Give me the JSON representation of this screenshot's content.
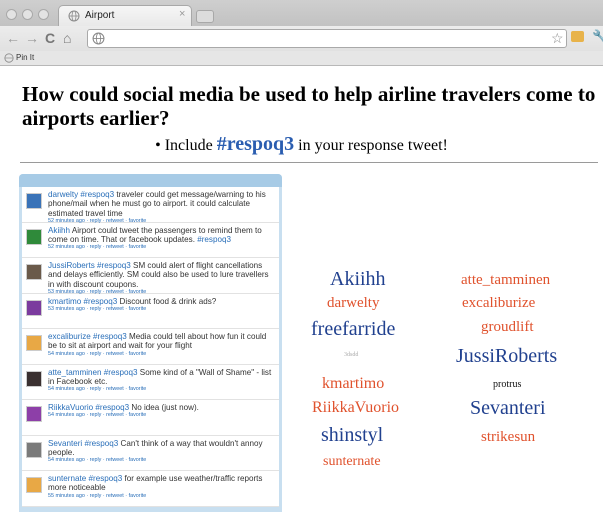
{
  "browser": {
    "tab_title": "Airport",
    "tab_close": "×",
    "bookmark_label": "Pin It",
    "nav": {
      "back": "←",
      "forward": "→",
      "reload": "C",
      "home": "⌂",
      "star": "☆",
      "wrench": "🔧"
    }
  },
  "page": {
    "headline": "How could social media be used to help airline travelers come to airports earlier?",
    "instruction_prefix": "• Include",
    "hashtag": "#respoq3",
    "instruction_suffix": "in your response tweet!"
  },
  "tweets": [
    {
      "user": "darwelty",
      "tag": "#respoq3",
      "text": " traveler could get message/warning to his phone/mail when he must go to airport. it could calculate estimated travel time",
      "meta": "52 minutes ago · reply · retweet · favorite",
      "avatar_color": "#3a73b8"
    },
    {
      "user": "Akiihh",
      "tag": "",
      "text": " Airport could tweet the passengers to remind them to come on time. That or facebook updates. ",
      "tag_after": "#respoq3",
      "meta": "52 minutes ago · reply · retweet · favorite",
      "avatar_color": "#2f8a3a"
    },
    {
      "user": "JussiRoberts",
      "tag": "#respoq3",
      "text": " SM could alert of flight cancellations and delays efficiently. SM could also be used to lure travellers in with discount coupons.",
      "meta": "53 minutes ago · reply · retweet · favorite",
      "avatar_color": "#6a5a4a"
    },
    {
      "user": "kmartimo",
      "tag": "#respoq3",
      "text": " Discount food & drink ads?",
      "meta": "53 minutes ago · reply · retweet · favorite",
      "avatar_color": "#7b3b9e"
    },
    {
      "user": "excaliburize",
      "tag": "#respoq3",
      "text": " Media could tell about how fun it could be to sit at airport and wait for your flight",
      "meta": "54 minutes ago · reply · retweet · favorite",
      "avatar_color": "#e8a845"
    },
    {
      "user": "atte_tamminen",
      "tag": "#respoq3",
      "text": " Some kind of a \"Wall of Shame\" - list in Facebook etc.",
      "meta": "54 minutes ago · reply · retweet · favorite",
      "avatar_color": "#3a3030"
    },
    {
      "user": "RiikkaVuorio",
      "tag": "#respoq3",
      "text": " No idea (just now).",
      "meta": "54 minutes ago · reply · retweet · favorite",
      "avatar_color": "#8d3fa8"
    },
    {
      "user": "Sevanteri",
      "tag": "#respoq3",
      "text": " Can't think of a way that wouldn't annoy people.",
      "meta": "54 minutes ago · reply · retweet · favorite",
      "avatar_color": "#7a7a7a"
    },
    {
      "user": "sunternate",
      "tag": "#respoq3",
      "text": " for example use weather/traffic reports more noticeable",
      "meta": "55 minutes ago · reply · retweet · favorite",
      "avatar_color": "#e8a845"
    }
  ],
  "word_cloud": [
    {
      "word": "Akiihh",
      "color": "blue"
    },
    {
      "word": "atte_tamminen",
      "color": "red"
    },
    {
      "word": "darwelty",
      "color": "red"
    },
    {
      "word": "excaliburize",
      "color": "red"
    },
    {
      "word": "freefarride",
      "color": "blue"
    },
    {
      "word": "groudlift",
      "color": "red"
    },
    {
      "word": "3dsdd",
      "color": "faint"
    },
    {
      "word": "JussiRoberts",
      "color": "blue"
    },
    {
      "word": "kmartimo",
      "color": "red"
    },
    {
      "word": "protrus",
      "color": "dark"
    },
    {
      "word": "RiikkaVuorio",
      "color": "red"
    },
    {
      "word": "Sevanteri",
      "color": "blue"
    },
    {
      "word": "shinstyl",
      "color": "blue"
    },
    {
      "word": "strikesun",
      "color": "red"
    },
    {
      "word": "sunternate",
      "color": "red"
    }
  ]
}
